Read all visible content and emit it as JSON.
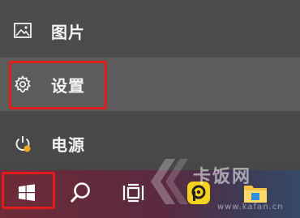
{
  "menu": {
    "items": [
      {
        "label": "图片",
        "icon": "photos-icon"
      },
      {
        "label": "设置",
        "icon": "gear-icon"
      },
      {
        "label": "电源",
        "icon": "power-icon"
      }
    ]
  },
  "taskbar": {
    "buttons": [
      {
        "icon": "windows-start-icon"
      },
      {
        "icon": "search-icon"
      },
      {
        "icon": "task-view-icon"
      },
      {
        "icon": "app-icon"
      },
      {
        "icon": "file-explorer-icon"
      }
    ]
  },
  "watermark": {
    "text": "卡饭网",
    "url": "www.kafan.cn"
  },
  "colors": {
    "highlight": "#e21b1b",
    "selected_row": "#5c5c5c",
    "power_dot": "#f5a623"
  }
}
